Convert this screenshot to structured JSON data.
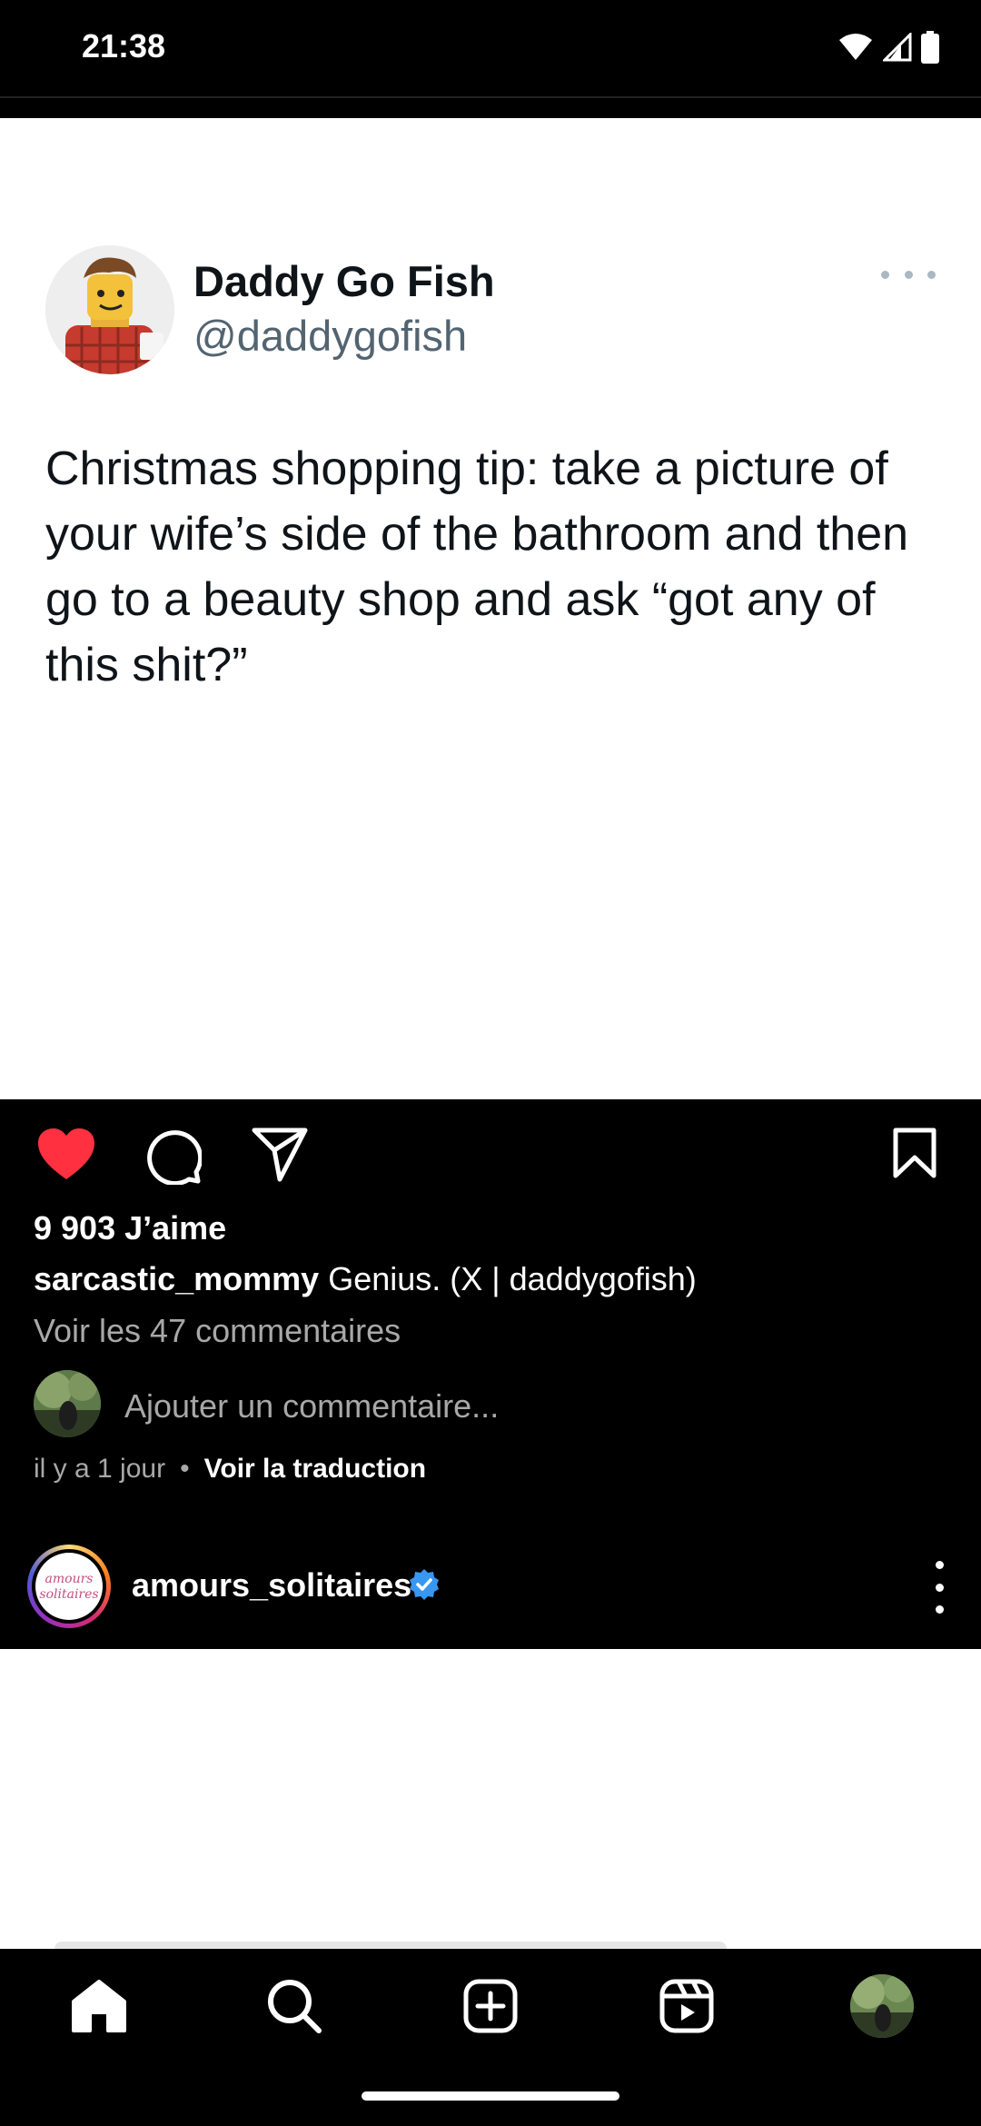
{
  "status_bar": {
    "time": "21:38",
    "icons": [
      "wifi-icon",
      "signal-icon",
      "battery-icon"
    ]
  },
  "tweet": {
    "display_name": "Daddy Go Fish",
    "handle": "@daddygofish",
    "text": "Christmas shopping tip: take a picture of your wife’s side of the bathroom and then go to a beauty shop and ask “got any of this shit?”"
  },
  "post": {
    "likes_text": "9 903 J’aime",
    "caption_user": "sarcastic_mommy",
    "caption_text": " Genius. (X | daddygofish)",
    "view_comments": "Voir les 47 commentaires",
    "add_comment_placeholder": "Ajouter un commentaire...",
    "time_ago": "il y a 1 jour",
    "translate_label": "Voir la traduction",
    "liked": true,
    "like_color": "#ff3040"
  },
  "next_post": {
    "username": "amours_solitaires",
    "verified": true,
    "avatar_text": "amours solitaires",
    "verified_color": "#3897f0"
  },
  "nav": {
    "items": [
      "home-icon",
      "search-icon",
      "create-icon",
      "reels-icon",
      "profile-avatar"
    ]
  }
}
